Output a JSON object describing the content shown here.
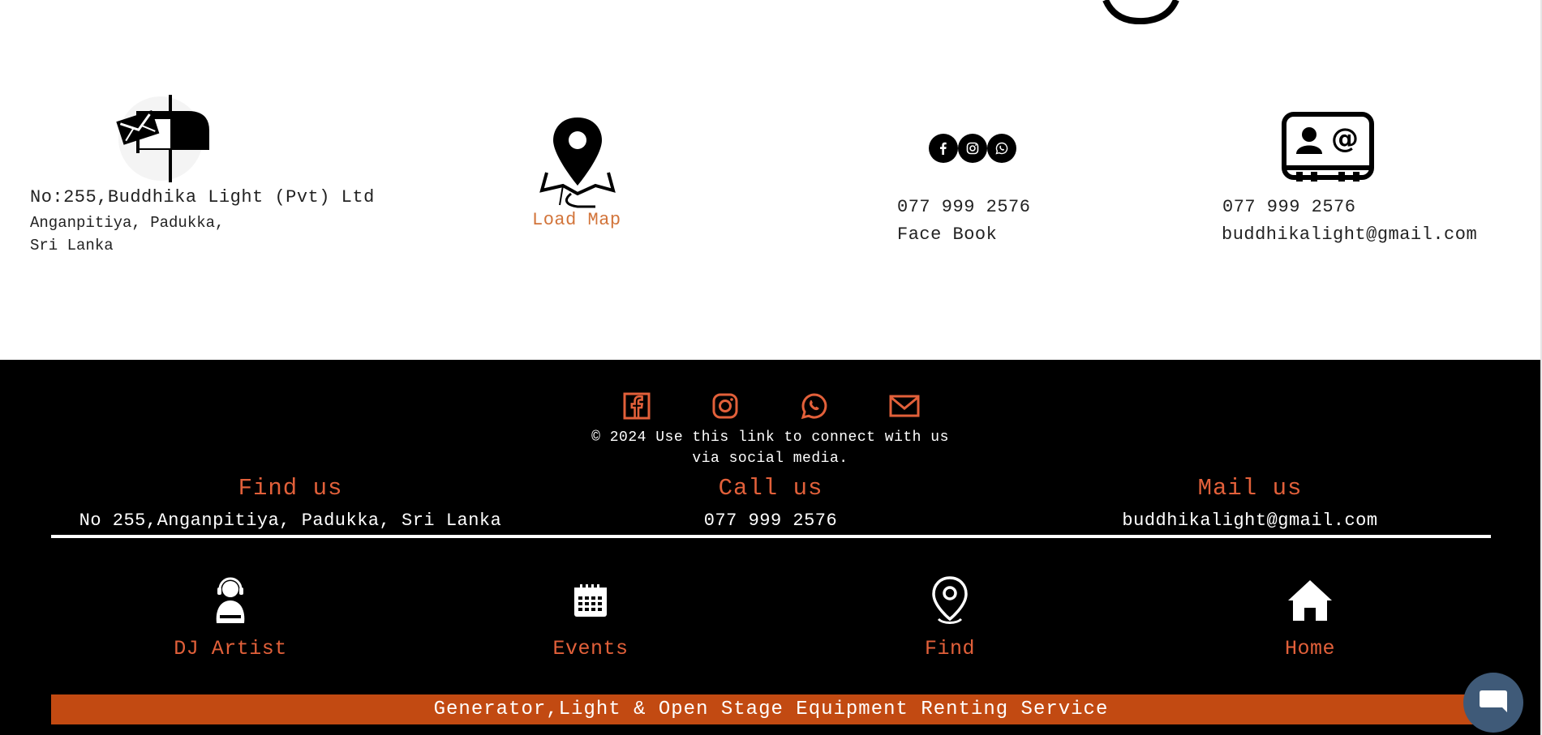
{
  "contact": {
    "address_line1": "No:255,Buddhika Light (Pvt) Ltd",
    "address_line2": "Anganpitiya, Padukka,",
    "address_line3": "Sri Lanka",
    "load_map": "Load Map",
    "phone_social": "077 999 2576",
    "facebook_label": "Face Book",
    "phone_mail": "077 999 2576",
    "email": "buddhikalight@gmail.com"
  },
  "footer": {
    "social_icons": [
      "facebook-icon",
      "instagram-icon",
      "whatsapp-icon",
      "mail-icon"
    ],
    "copyright_line1": "© 2024 Use this link to connect with us",
    "copyright_line2": "via social media.",
    "find_us": {
      "heading": "Find us",
      "value": "No 255,Anganpitiya, Padukka, Sri Lanka"
    },
    "call_us": {
      "heading": "Call us",
      "value": "077 999 2576"
    },
    "mail_us": {
      "heading": "Mail us",
      "value": "buddhikalight@gmail.com"
    },
    "nav": [
      {
        "label": "DJ Artist",
        "icon": "dj-artist-icon"
      },
      {
        "label": "Events",
        "icon": "calendar-icon"
      },
      {
        "label": "Find",
        "icon": "location-pin-icon"
      },
      {
        "label": "Home",
        "icon": "home-icon"
      }
    ],
    "banner": "Generator,Light & Open Stage Equipment Renting Service"
  },
  "colors": {
    "accent_orange": "#e2603a",
    "link_orange": "#d2743a",
    "banner": "#c24a12",
    "footer_bg": "#000000",
    "chat_button": "#3f5a78"
  }
}
